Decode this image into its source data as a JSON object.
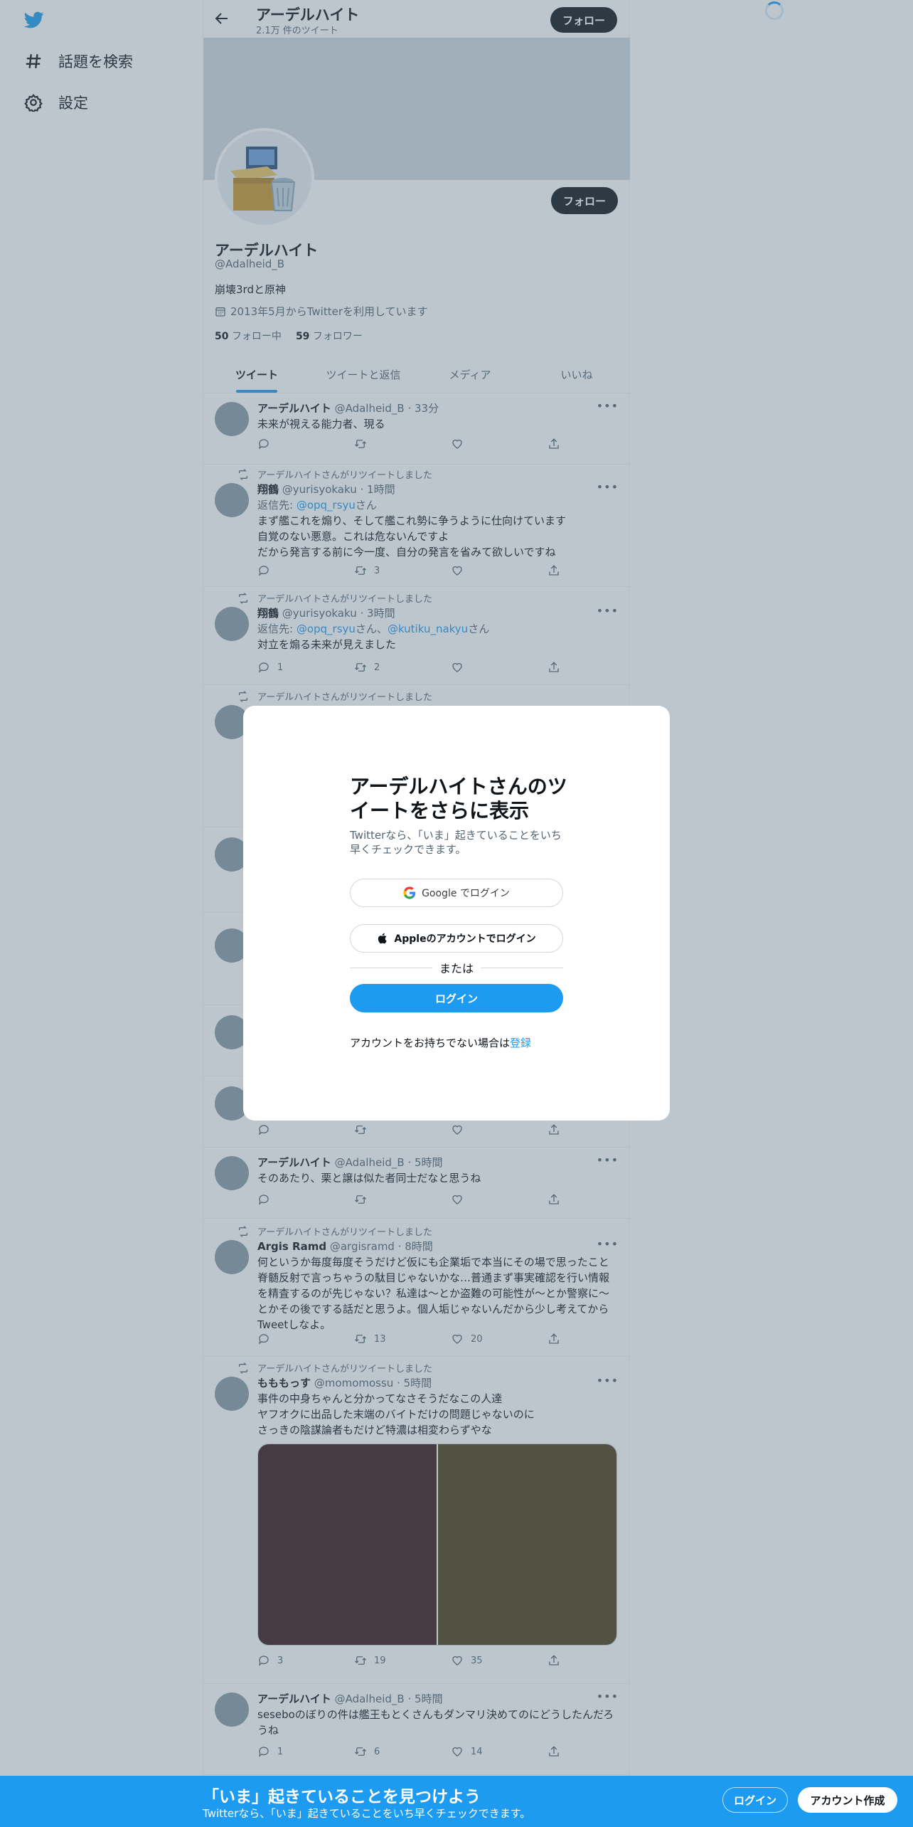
{
  "nav": {
    "logo": "twitter-bird-icon",
    "explore_label": "話題を検索",
    "settings_label": "設定"
  },
  "header": {
    "name": "アーデルハイト",
    "tweet_count": "2.1万 件のツイート",
    "follow_label": "フォロー"
  },
  "profile": {
    "name": "アーデルハイト",
    "handle": "@Adalheid_B",
    "bio": "崩壊3rdと原神",
    "joined": "2013年5月からTwitterを利用しています",
    "following_count": "50",
    "following_label": "フォロー中",
    "followers_count": "59",
    "followers_label": "フォロワー",
    "follow_label": "フォロー"
  },
  "tabs": [
    "ツイート",
    "ツイートと返信",
    "メディア",
    "いいね"
  ],
  "tweets": [
    {
      "name": "アーデルハイト",
      "meta": "@Adalheid_B · 33分",
      "text": "未来が視える能力者、現る",
      "replies": "",
      "retweets": "",
      "likes": ""
    },
    {
      "rt": "アーデルハイトさんがリツイートしました",
      "name": "翔鶴",
      "meta": "@yurisyokaku · 1時間",
      "reply_prefix": "返信先: ",
      "reply_to": "@opq_rsyu",
      "reply_suffix": "さん",
      "text": "まず艦これを煽り、そして艦これ勢に争うように仕向けています\n自覚のない悪意。これは危ないんですよ\nだから発言する前に今一度、自分の発言を省みて欲しいですね",
      "replies": "",
      "retweets": "3",
      "likes": ""
    },
    {
      "rt": "アーデルハイトさんがリツイートしました",
      "name": "翔鶴",
      "meta": "@yurisyokaku · 3時間",
      "reply_prefix": "返信先: ",
      "reply_to": "@opq_rsyu",
      "reply_mid": "さん、",
      "reply_to2": "@kutiku_nakyu",
      "reply_suffix": "さん",
      "text": "対立を煽る未来が見えました",
      "replies": "1",
      "retweets": "2",
      "likes": ""
    },
    {
      "rt": "アーデルハイトさんがリツイートしました"
    },
    {
      "name": "アーデルハイト",
      "meta": "@Adalheid_B · 5時間",
      "text": "そのあたり、栗と譲は似た者同士だなと思うね",
      "replies": "",
      "retweets": "",
      "likes": ""
    },
    {
      "rt": "アーデルハイトさんがリツイートしました",
      "name": "Argis Ramd",
      "meta": "@argisramd · 8時間",
      "text": "何というか毎度毎度そうだけど仮にも企業垢で本当にその場で思ったこと脊髄反射で言っちゃうの駄目じゃないかな…普通まず事実確認を行い情報を精査するのが先じゃない？私達は〜とか盗難の可能性が〜とか警察に〜とかその後でする話だと思うよ。個人垢じゃないんだから少し考えてからTweetしなよ。",
      "replies": "",
      "retweets": "13",
      "likes": "20"
    },
    {
      "rt": "アーデルハイトさんがリツイートしました",
      "name": "もももっす",
      "meta": "@momomossu · 5時間",
      "text": "事件の中身ちゃんと分かってなさそうだなこの人達\nヤフオクに出品した末端のバイトだけの問題じゃないのに\nさっきの陰謀論者もだけど特濃は相変わらずやな",
      "replies": "3",
      "retweets": "19",
      "likes": "35",
      "media_colors": [
        "#3a1818",
        "#4e3d18"
      ]
    },
    {
      "name": "アーデルハイト",
      "meta": "@Adalheid_B · 5時間",
      "text": "seseboのぼりの件は艦王もとくさんもダンマリ決めてのにどうしたんだろうね",
      "replies": "1",
      "retweets": "6",
      "likes": "14"
    }
  ],
  "modal": {
    "title": "アーデルハイトさんのツイートをさらに表示",
    "subtitle": "Twitterなら、「いま」起きていることをいち早くチェックできます。",
    "google_label": "Google でログイン",
    "apple_label": "Appleのアカウントでログイン",
    "or_label": "または",
    "login_label": "ログイン",
    "signup_prompt": "アカウントをお持ちでない場合は",
    "signup_link": "登録"
  },
  "bottom_bar": {
    "title": "「いま」起きていることを見つけよう",
    "subtitle": "Twitterなら、「いま」起きていることをいち早くチェックできます。",
    "login_label": "ログイン",
    "signup_label": "アカウント作成"
  },
  "colors": {
    "accent": "#1d9bf0",
    "text": "#0f1419",
    "muted": "#536471"
  }
}
